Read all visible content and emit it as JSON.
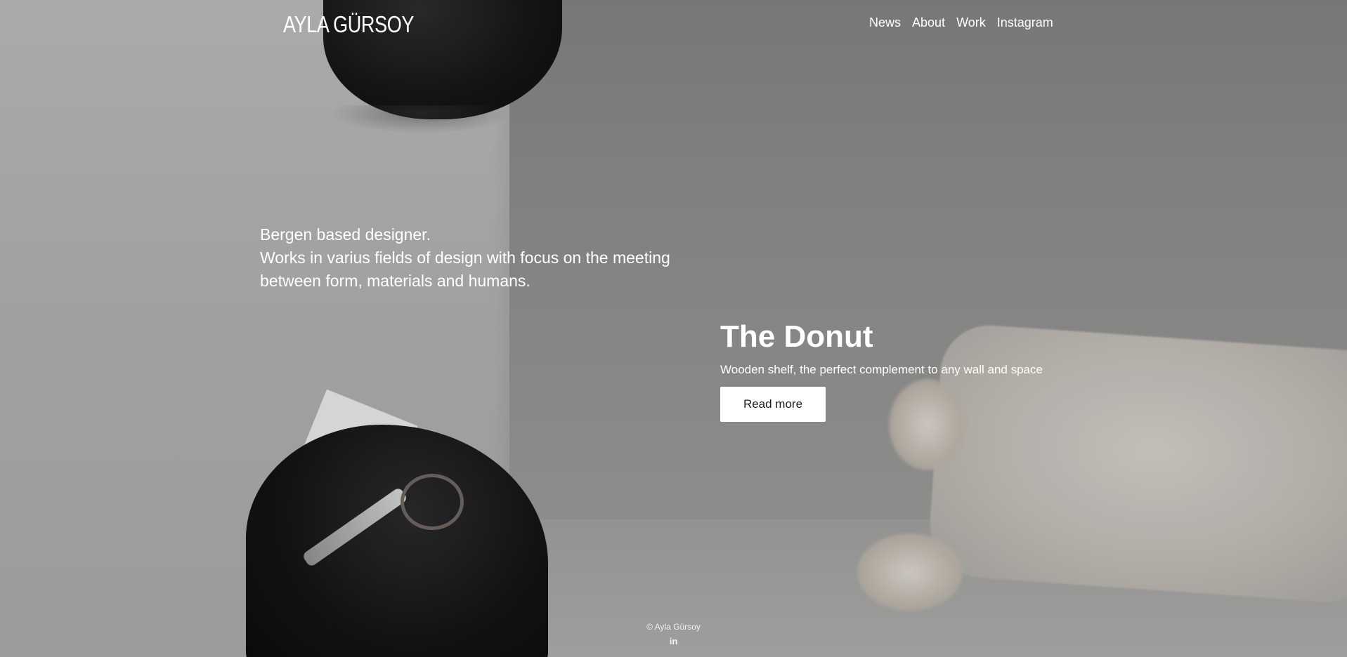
{
  "header": {
    "logo_text": "AYLA GÜRSOY",
    "nav": [
      {
        "label": "News"
      },
      {
        "label": "About"
      },
      {
        "label": "Work"
      },
      {
        "label": "Instagram"
      }
    ]
  },
  "intro": {
    "lines": [
      "Bergen based designer.",
      "Works in varius fields of design with focus on the meeting",
      "between form, materials and humans."
    ]
  },
  "feature": {
    "title": "The Donut",
    "subtitle": "Wooden shelf, the perfect complement to any wall and space",
    "button_label": "Read more"
  },
  "footer": {
    "copyright": "© Ayla Gürsoy",
    "icon_glyph": "in",
    "icon_name": "linkedin-icon"
  }
}
